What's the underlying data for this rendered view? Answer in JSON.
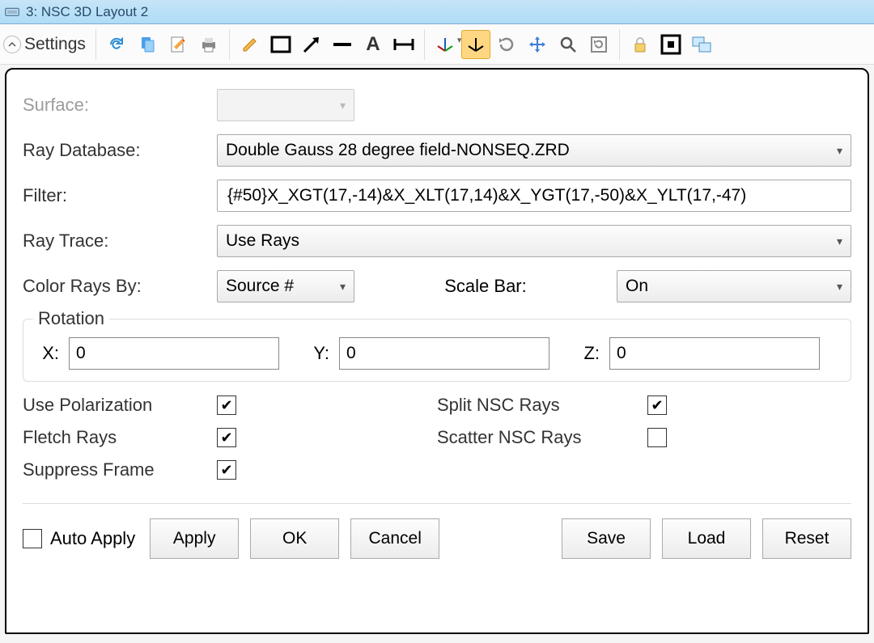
{
  "window": {
    "title": "3: NSC 3D Layout 2"
  },
  "toolbar": {
    "settings": "Settings"
  },
  "labels": {
    "surface": "Surface:",
    "ray_database": "Ray Database:",
    "filter": "Filter:",
    "ray_trace": "Ray Trace:",
    "color_rays_by": "Color Rays By:",
    "scale_bar": "Scale Bar:",
    "rotation": "Rotation",
    "x": "X:",
    "y": "Y:",
    "z": "Z:",
    "use_polarization": "Use Polarization",
    "split_nsc": "Split NSC Rays",
    "fletch_rays": "Fletch Rays",
    "scatter_nsc": "Scatter NSC Rays",
    "suppress_frame": "Suppress Frame",
    "auto_apply": "Auto Apply"
  },
  "values": {
    "surface": "",
    "ray_database": "Double Gauss 28 degree field-NONSEQ.ZRD",
    "filter": "{#50}X_XGT(17,-14)&X_XLT(17,14)&X_YGT(17,-50)&X_YLT(17,-47)",
    "ray_trace": "Use Rays",
    "color_rays_by": "Source #",
    "scale_bar": "On",
    "rot_x": "0",
    "rot_y": "0",
    "rot_z": "0"
  },
  "checks": {
    "use_polarization": true,
    "split_nsc": true,
    "fletch_rays": true,
    "scatter_nsc": false,
    "suppress_frame": true,
    "auto_apply": false
  },
  "buttons": {
    "apply": "Apply",
    "ok": "OK",
    "cancel": "Cancel",
    "save": "Save",
    "load": "Load",
    "reset": "Reset"
  }
}
